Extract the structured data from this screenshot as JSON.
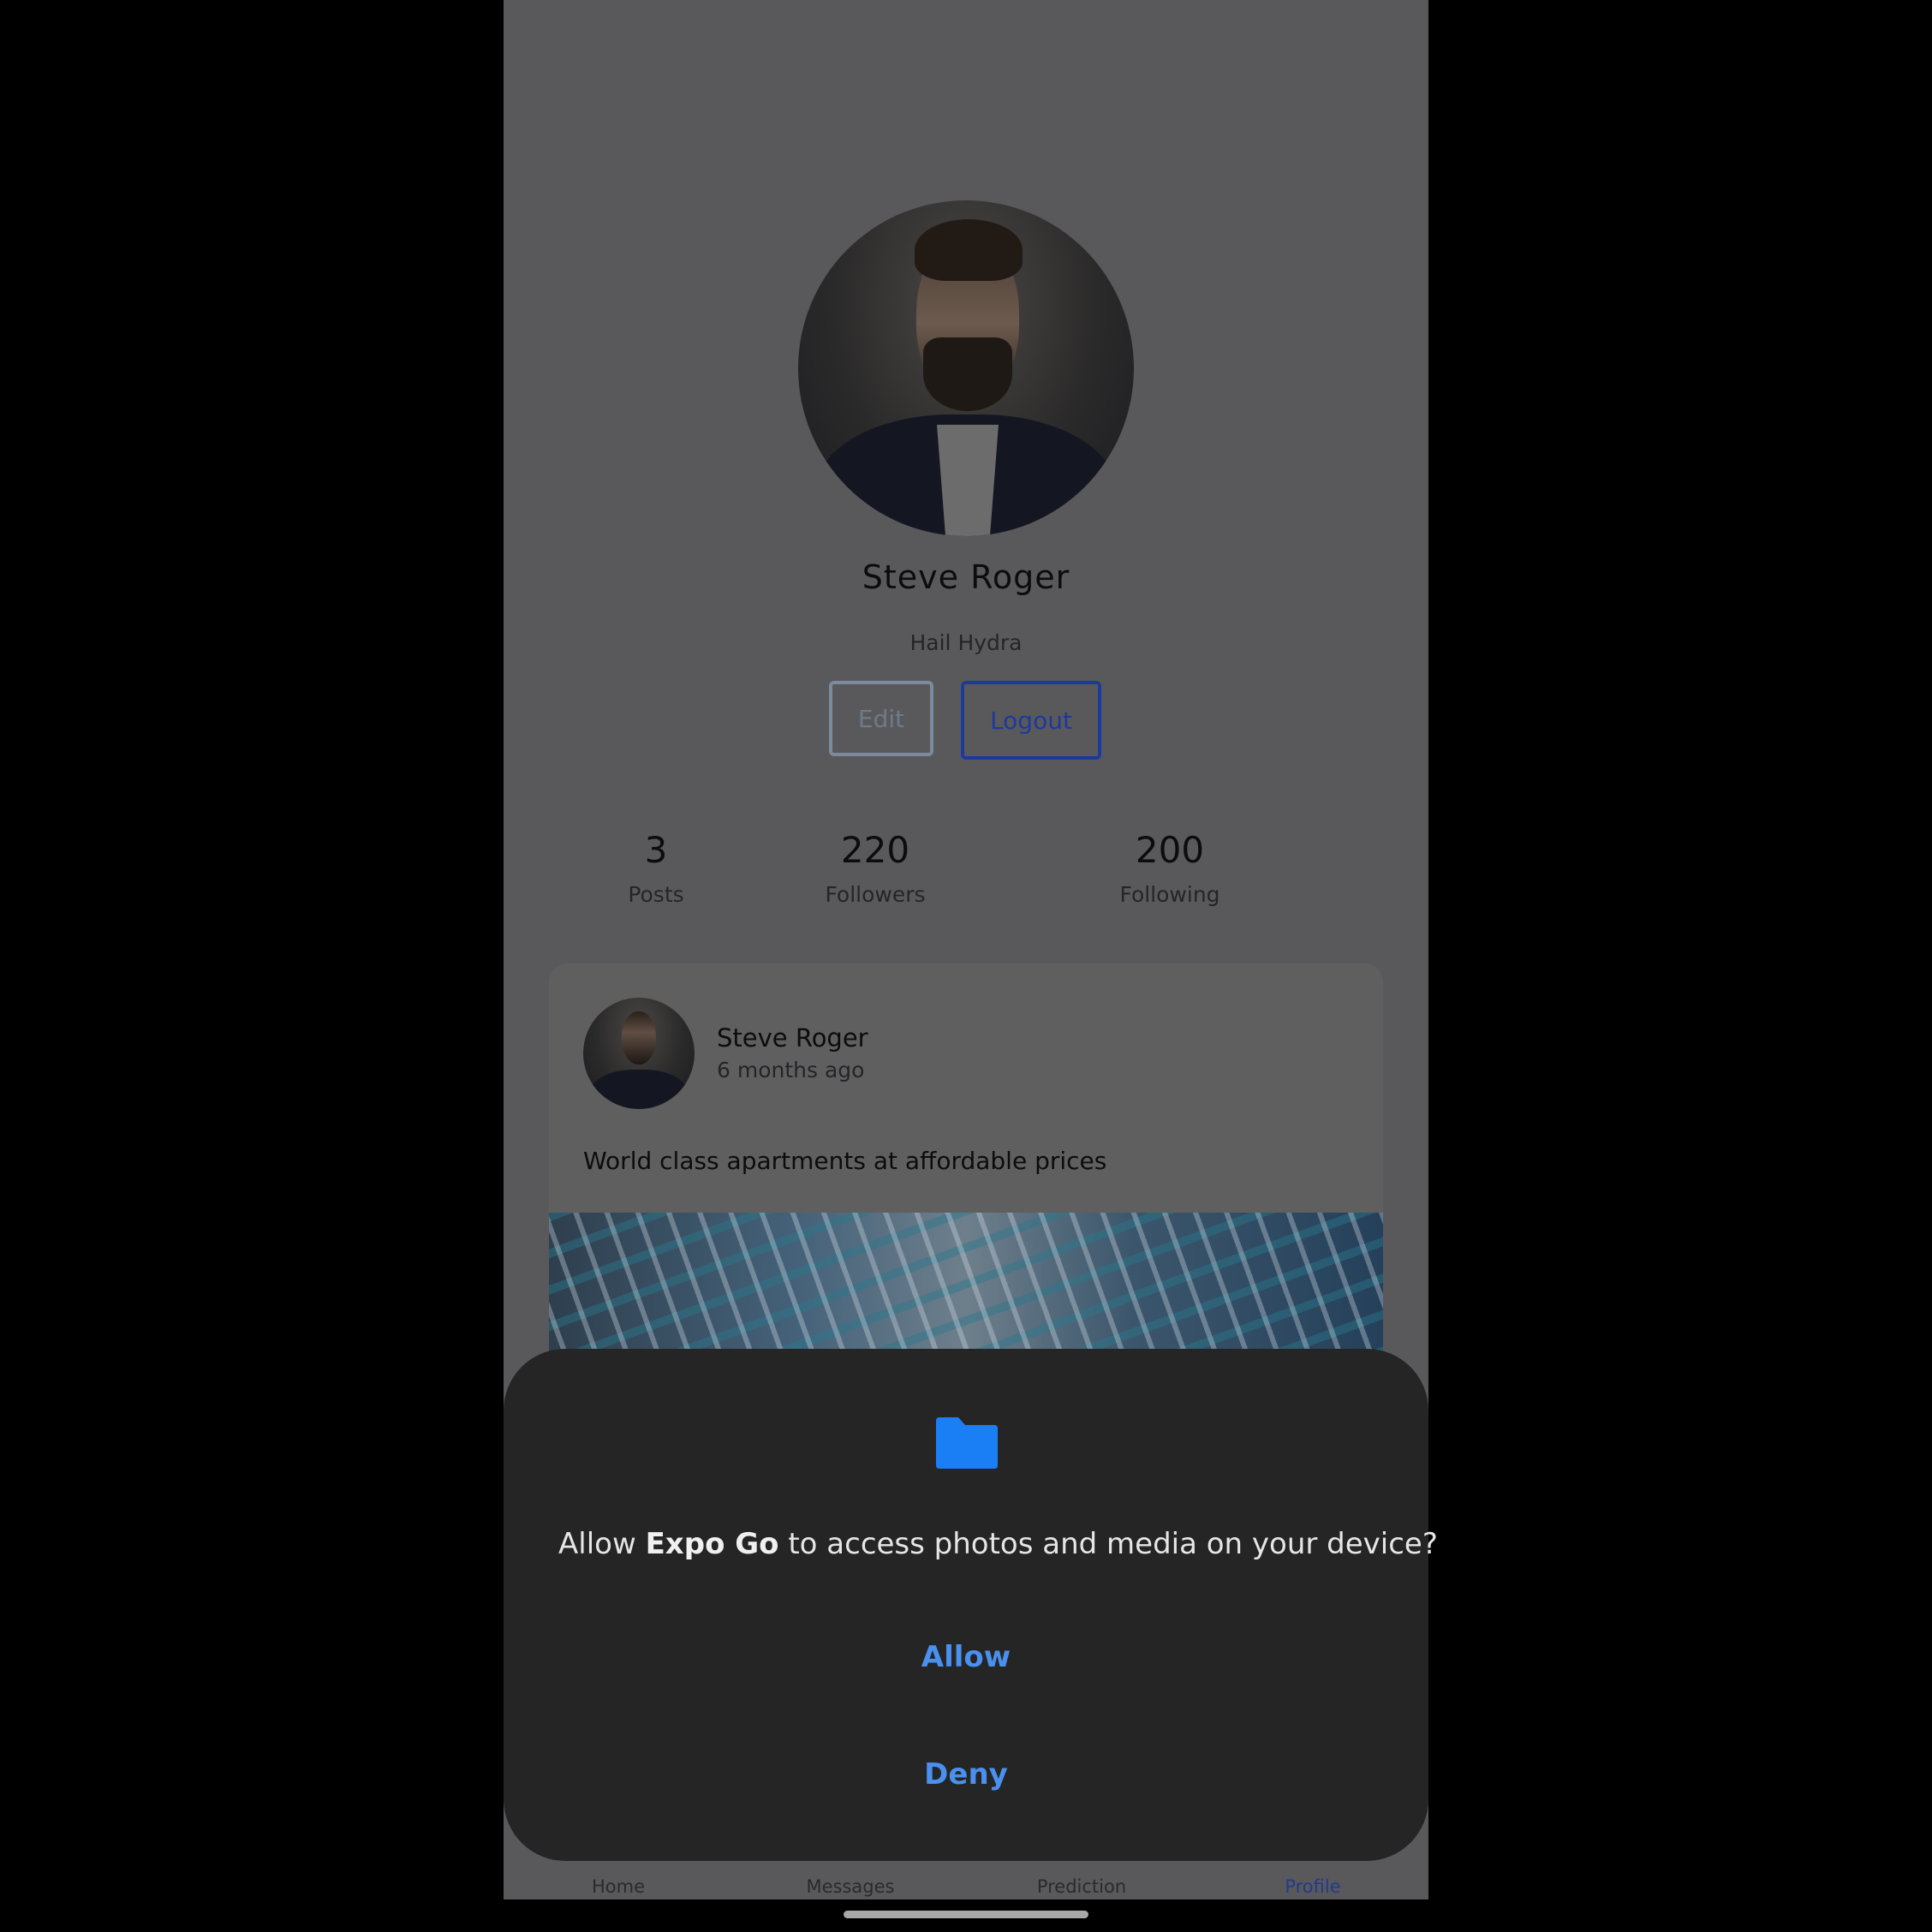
{
  "profile": {
    "name": "Steve Roger",
    "bio": "Hail Hydra",
    "edit_label": "Edit",
    "logout_label": "Logout"
  },
  "stats": [
    {
      "value": "3",
      "label": "Posts"
    },
    {
      "value": "220",
      "label": "Followers"
    },
    {
      "value": "200",
      "label": "Following"
    }
  ],
  "post": {
    "author": "Steve Roger",
    "time": "6 months ago",
    "text": "World class apartments at affordable prices"
  },
  "tabs": [
    {
      "label": "Home"
    },
    {
      "label": "Messages"
    },
    {
      "label": "Prediction"
    },
    {
      "label": "Profile",
      "active": true
    }
  ],
  "permission_dialog": {
    "icon": "folder-icon",
    "prompt_prefix": "Allow ",
    "app_name": "Expo Go",
    "prompt_suffix": " to access photos and media on your device?",
    "allow_label": "Allow",
    "deny_label": "Deny"
  },
  "colors": {
    "accent": "#4a90ee",
    "folder": "#1a7ff5",
    "logout_border": "#1c3a9a",
    "sheet_bg": "#252525"
  }
}
